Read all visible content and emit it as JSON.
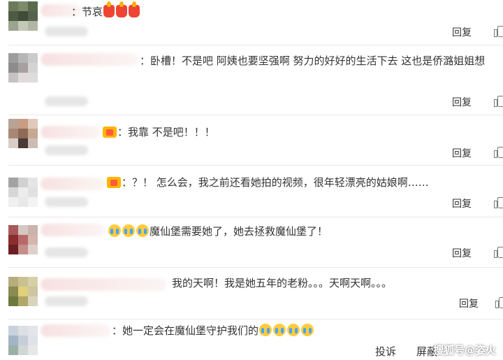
{
  "comments": [
    {
      "text": "：节哀",
      "reply": "回复"
    },
    {
      "text": "：卧槽！不是吧 阿姨也要坚强啊 努力的好好的生活下去 这也是侨潞姐姐想",
      "reply": "回复"
    },
    {
      "text": "：我靠 不是吧！！！",
      "reply": "回复"
    },
    {
      "text": "：？！ 怎么会，我之前还看她拍的视频，很年轻漂亮的姑娘啊……",
      "reply": "回复"
    },
    {
      "text": "魔仙堡需要她了，她去拯救魔仙堡了！",
      "reply": "回复"
    },
    {
      "text": "我的天啊！我是她五年的老粉。。。天啊天啊。。。",
      "reply": "回复"
    },
    {
      "text": "：她一定会在魔仙堡守护我们的",
      "reply": ""
    }
  ],
  "bottom_bar": {
    "report": "投诉",
    "block": "屏蔽"
  },
  "watermark": "搜狐号@姿火"
}
